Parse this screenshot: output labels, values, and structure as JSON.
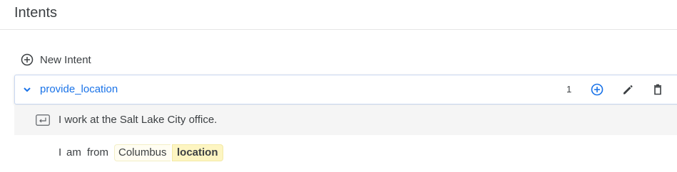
{
  "header": {
    "title": "Intents"
  },
  "actions": {
    "new_intent_label": "New Intent"
  },
  "intent": {
    "name": "provide_location",
    "count": "1",
    "icons": [
      "chevron-down-icon",
      "add-circle-icon",
      "edit-icon",
      "delete-icon"
    ]
  },
  "example": {
    "text": "I work at the Salt Lake City office."
  },
  "annotated_example": {
    "word1": "I",
    "word2": "am",
    "word3": "from",
    "entity_value": "Columbus",
    "entity_label": "location"
  },
  "colors": {
    "accent": "#1a73e8",
    "entity_highlight": "#fdf5c2"
  }
}
